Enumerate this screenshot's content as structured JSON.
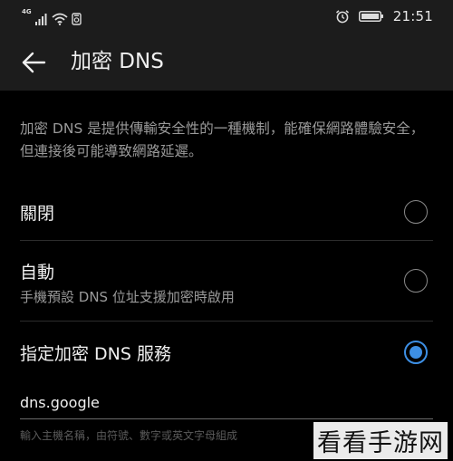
{
  "status_bar": {
    "network_label": "4G",
    "time": "21:51"
  },
  "header": {
    "title": "加密 DNS"
  },
  "description": "加密 DNS 是提供傳輸安全性的一種機制，能確保網路體驗安全，但連接後可能導致網路延遲。",
  "options": [
    {
      "label": "關閉",
      "subtitle": "",
      "selected": false
    },
    {
      "label": "自動",
      "subtitle": "手機預設 DNS 位址支援加密時啟用",
      "selected": false
    },
    {
      "label": "指定加密 DNS 服務",
      "subtitle": "",
      "selected": true
    }
  ],
  "dns_input": {
    "value": "dns.google",
    "helper": "輸入主機名稱，由符號、數字或英文字母組成"
  },
  "watermark": "看看手游网",
  "colors": {
    "accent": "#3d8fe4",
    "background": "#000000",
    "bar": "#1c1c1c"
  }
}
